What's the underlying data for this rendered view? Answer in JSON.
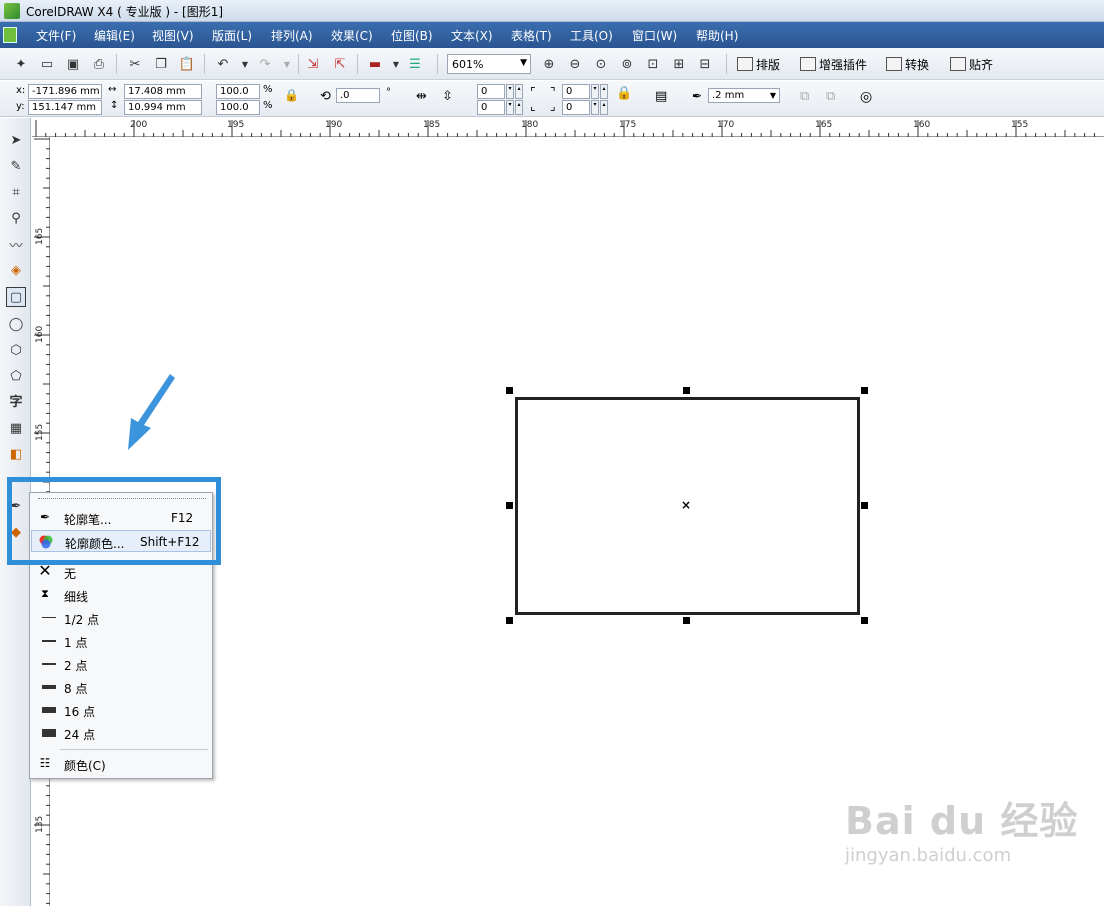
{
  "window": {
    "title": "CorelDRAW X4 ( 专业版 ) - [图形1]"
  },
  "menubar": {
    "items": [
      "文件(F)",
      "编辑(E)",
      "视图(V)",
      "版面(L)",
      "排列(A)",
      "效果(C)",
      "位图(B)",
      "文本(X)",
      "表格(T)",
      "工具(O)",
      "窗口(W)",
      "帮助(H)"
    ]
  },
  "toolbar": {
    "zoom_value": "601%",
    "text_buttons": [
      "排版",
      "增强插件",
      "转换",
      "贴齐"
    ]
  },
  "propbar": {
    "x_label": "x:",
    "x_value": "-171.896 mm",
    "y_label": "y:",
    "y_value": "151.147 mm",
    "width_value": "17.408 mm",
    "height_value": "10.994 mm",
    "scale_x": "100.0",
    "scale_y": "100.0",
    "percent": "%",
    "rotation": ".0",
    "degree": "°",
    "corner_tl": "0",
    "corner_bl": "0",
    "corner_tr": "0",
    "corner_br": "0",
    "outline_width": ".2 mm"
  },
  "ruler_h": {
    "labels": [
      "200",
      "195",
      "190",
      "185",
      "180",
      "175",
      "170",
      "165",
      "160",
      "155"
    ]
  },
  "ruler_v": {
    "labels": [
      "165",
      "160",
      "155",
      "135"
    ]
  },
  "popup": {
    "items": [
      {
        "label": "轮廓笔...",
        "shortcut": "F12",
        "icon": "outline-pen-icon"
      },
      {
        "label": "轮廓颜色...",
        "shortcut": "Shift+F12",
        "icon": "color-wheel-icon"
      },
      {
        "label": "无",
        "shortcut": "",
        "icon": "none-x-icon"
      },
      {
        "label": "细线",
        "shortcut": "",
        "icon": "hairline-icon"
      },
      {
        "label": "1/2 点",
        "shortcut": "",
        "icon": "line-weight-icon"
      },
      {
        "label": "1 点",
        "shortcut": "",
        "icon": "line-weight-icon"
      },
      {
        "label": "2 点",
        "shortcut": "",
        "icon": "line-weight-icon"
      },
      {
        "label": "8 点",
        "shortcut": "",
        "icon": "line-weight-icon"
      },
      {
        "label": "16 点",
        "shortcut": "",
        "icon": "line-weight-icon"
      },
      {
        "label": "24 点",
        "shortcut": "",
        "icon": "line-weight-icon"
      },
      {
        "label": "颜色(C)",
        "shortcut": "",
        "icon": "color-palette-icon"
      }
    ]
  },
  "watermark": {
    "brand": "Bai du 经验",
    "url": "jingyan.baidu.com"
  },
  "colors": {
    "accent": "#2f8fd8",
    "menubar": "#2e5c99"
  }
}
